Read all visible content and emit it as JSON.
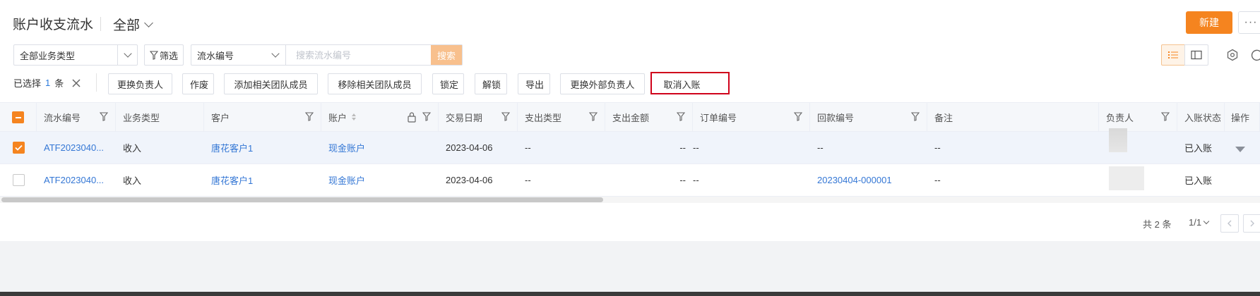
{
  "header": {
    "title": "账户收支流水",
    "scope": "全部",
    "new_button": "新建",
    "more_button": "···"
  },
  "filters": {
    "business_type": "全部业务类型",
    "filter_button": "筛选",
    "search_field": "流水编号",
    "search_placeholder": "搜索流水编号",
    "search_button": "搜索"
  },
  "selection": {
    "prefix": "已选择",
    "count": "1",
    "unit": "条"
  },
  "actions": [
    "更换负责人",
    "作废",
    "添加相关团队成员",
    "移除相关团队成员",
    "锁定",
    "解锁",
    "导出",
    "更换外部负责人",
    "取消入账"
  ],
  "table": {
    "columns": [
      "流水编号",
      "业务类型",
      "客户",
      "账户",
      "交易日期",
      "支出类型",
      "支出金额",
      "订单编号",
      "回款编号",
      "备注",
      "负责人",
      "入账状态",
      "操作"
    ],
    "rows": [
      {
        "selected": true,
        "serial": "ATF2023040...",
        "biz_type": "收入",
        "customer": "唐花客户1",
        "account": "现金账户",
        "date": "2023-04-06",
        "expense_type": "--",
        "expense_amount": "--",
        "order_no": "--",
        "payment_no": "--",
        "remark": "--",
        "status": "已入账"
      },
      {
        "selected": false,
        "serial": "ATF2023040...",
        "biz_type": "收入",
        "customer": "唐花客户1",
        "account": "现金账户",
        "date": "2023-04-06",
        "expense_type": "--",
        "expense_amount": "--",
        "order_no": "--",
        "payment_no": "20230404-000001",
        "remark": "--",
        "status": "已入账"
      }
    ]
  },
  "pagination": {
    "total": "共 2 条",
    "page": "1/1"
  },
  "colors": {
    "accent": "#f5841f",
    "link": "#3477d5",
    "highlight_border": "#d0021b"
  }
}
